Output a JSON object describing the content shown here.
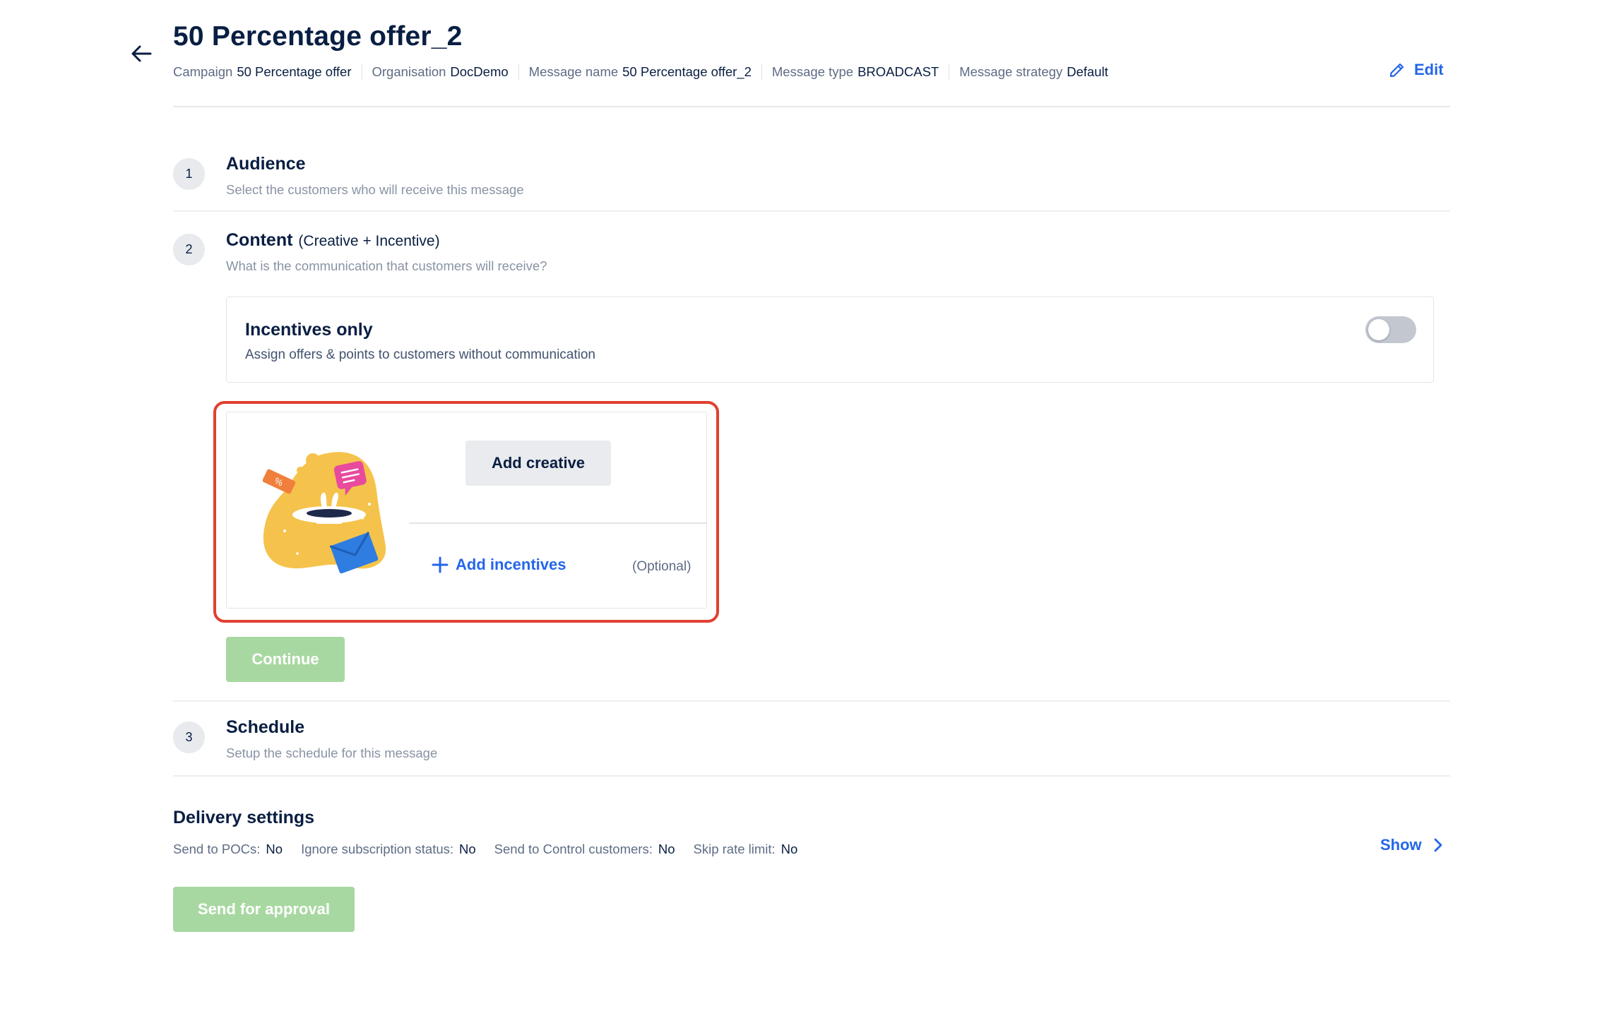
{
  "header": {
    "title": "50 Percentage offer_2",
    "edit_label": "Edit",
    "meta": [
      {
        "label": "Campaign",
        "value": "50 Percentage offer"
      },
      {
        "label": "Organisation",
        "value": "DocDemo"
      },
      {
        "label": "Message name",
        "value": "50 Percentage offer_2"
      },
      {
        "label": "Message type",
        "value": "BROADCAST"
      },
      {
        "label": "Message strategy",
        "value": "Default"
      }
    ]
  },
  "steps": {
    "audience": {
      "number": "1",
      "title": "Audience",
      "description": "Select the customers who will receive this message"
    },
    "content": {
      "number": "2",
      "title": "Content",
      "subtitle": "(Creative + Incentive)",
      "description": "What is the communication that customers will receive?"
    },
    "schedule": {
      "number": "3",
      "title": "Schedule",
      "description": "Setup the schedule for this message"
    }
  },
  "incentives_only": {
    "title": "Incentives only",
    "description": "Assign offers & points to customers without communication",
    "enabled": false
  },
  "creative": {
    "add_creative_label": "Add creative",
    "add_incentives_label": "Add incentives",
    "optional_label": "(Optional)"
  },
  "continue_label": "Continue",
  "delivery": {
    "title": "Delivery settings",
    "items": [
      {
        "label": "Send to POCs:",
        "value": "No"
      },
      {
        "label": "Ignore subscription status:",
        "value": "No"
      },
      {
        "label": "Send to Control customers:",
        "value": "No"
      },
      {
        "label": "Skip rate limit:",
        "value": "No"
      }
    ],
    "show_label": "Show"
  },
  "send_for_approval_label": "Send for approval",
  "colors": {
    "accent": "#2466ea",
    "highlight": "#e0412f",
    "disabled_green": "#a8d8a1"
  }
}
